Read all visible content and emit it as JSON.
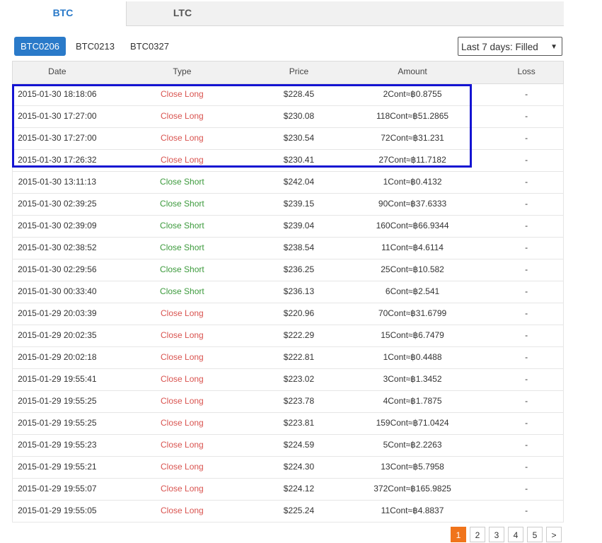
{
  "tabs": [
    {
      "label": "BTC"
    },
    {
      "label": "LTC"
    }
  ],
  "contracts": [
    {
      "label": "BTC0206"
    },
    {
      "label": "BTC0213"
    },
    {
      "label": "BTC0327"
    }
  ],
  "filter": {
    "selected": "Last 7 days: Filled",
    "arrow": "▼"
  },
  "table": {
    "headers": [
      "Date",
      "Type",
      "Price",
      "Amount",
      "Loss"
    ],
    "rows": [
      {
        "date": "2015-01-30 18:18:06",
        "type": "Close Long",
        "price": "$228.45",
        "amount": "2Cont≈฿0.8755",
        "loss": "-"
      },
      {
        "date": "2015-01-30 17:27:00",
        "type": "Close Long",
        "price": "$230.08",
        "amount": "118Cont≈฿51.2865",
        "loss": "-"
      },
      {
        "date": "2015-01-30 17:27:00",
        "type": "Close Long",
        "price": "$230.54",
        "amount": "72Cont≈฿31.231",
        "loss": "-"
      },
      {
        "date": "2015-01-30 17:26:32",
        "type": "Close Long",
        "price": "$230.41",
        "amount": "27Cont≈฿11.7182",
        "loss": "-"
      },
      {
        "date": "2015-01-30 13:11:13",
        "type": "Close Short",
        "price": "$242.04",
        "amount": "1Cont≈฿0.4132",
        "loss": "-"
      },
      {
        "date": "2015-01-30 02:39:25",
        "type": "Close Short",
        "price": "$239.15",
        "amount": "90Cont≈฿37.6333",
        "loss": "-"
      },
      {
        "date": "2015-01-30 02:39:09",
        "type": "Close Short",
        "price": "$239.04",
        "amount": "160Cont≈฿66.9344",
        "loss": "-"
      },
      {
        "date": "2015-01-30 02:38:52",
        "type": "Close Short",
        "price": "$238.54",
        "amount": "11Cont≈฿4.6114",
        "loss": "-"
      },
      {
        "date": "2015-01-30 02:29:56",
        "type": "Close Short",
        "price": "$236.25",
        "amount": "25Cont≈฿10.582",
        "loss": "-"
      },
      {
        "date": "2015-01-30 00:33:40",
        "type": "Close Short",
        "price": "$236.13",
        "amount": "6Cont≈฿2.541",
        "loss": "-"
      },
      {
        "date": "2015-01-29 20:03:39",
        "type": "Close Long",
        "price": "$220.96",
        "amount": "70Cont≈฿31.6799",
        "loss": "-"
      },
      {
        "date": "2015-01-29 20:02:35",
        "type": "Close Long",
        "price": "$222.29",
        "amount": "15Cont≈฿6.7479",
        "loss": "-"
      },
      {
        "date": "2015-01-29 20:02:18",
        "type": "Close Long",
        "price": "$222.81",
        "amount": "1Cont≈฿0.4488",
        "loss": "-"
      },
      {
        "date": "2015-01-29 19:55:41",
        "type": "Close Long",
        "price": "$223.02",
        "amount": "3Cont≈฿1.3452",
        "loss": "-"
      },
      {
        "date": "2015-01-29 19:55:25",
        "type": "Close Long",
        "price": "$223.78",
        "amount": "4Cont≈฿1.7875",
        "loss": "-"
      },
      {
        "date": "2015-01-29 19:55:25",
        "type": "Close Long",
        "price": "$223.81",
        "amount": "159Cont≈฿71.0424",
        "loss": "-"
      },
      {
        "date": "2015-01-29 19:55:23",
        "type": "Close Long",
        "price": "$224.59",
        "amount": "5Cont≈฿2.2263",
        "loss": "-"
      },
      {
        "date": "2015-01-29 19:55:21",
        "type": "Close Long",
        "price": "$224.30",
        "amount": "13Cont≈฿5.7958",
        "loss": "-"
      },
      {
        "date": "2015-01-29 19:55:07",
        "type": "Close Long",
        "price": "$224.12",
        "amount": "372Cont≈฿165.9825",
        "loss": "-"
      },
      {
        "date": "2015-01-29 19:55:05",
        "type": "Close Long",
        "price": "$225.24",
        "amount": "11Cont≈฿4.8837",
        "loss": "-"
      }
    ]
  },
  "pagination": {
    "pages": [
      "1",
      "2",
      "3",
      "4",
      "5"
    ],
    "next": ">"
  },
  "colors": {
    "accent": "#2a7ac9",
    "close_long": "#d9534f",
    "close_short": "#3c9a3c",
    "page_active": "#f0741b",
    "highlight_box": "#1414d2"
  }
}
